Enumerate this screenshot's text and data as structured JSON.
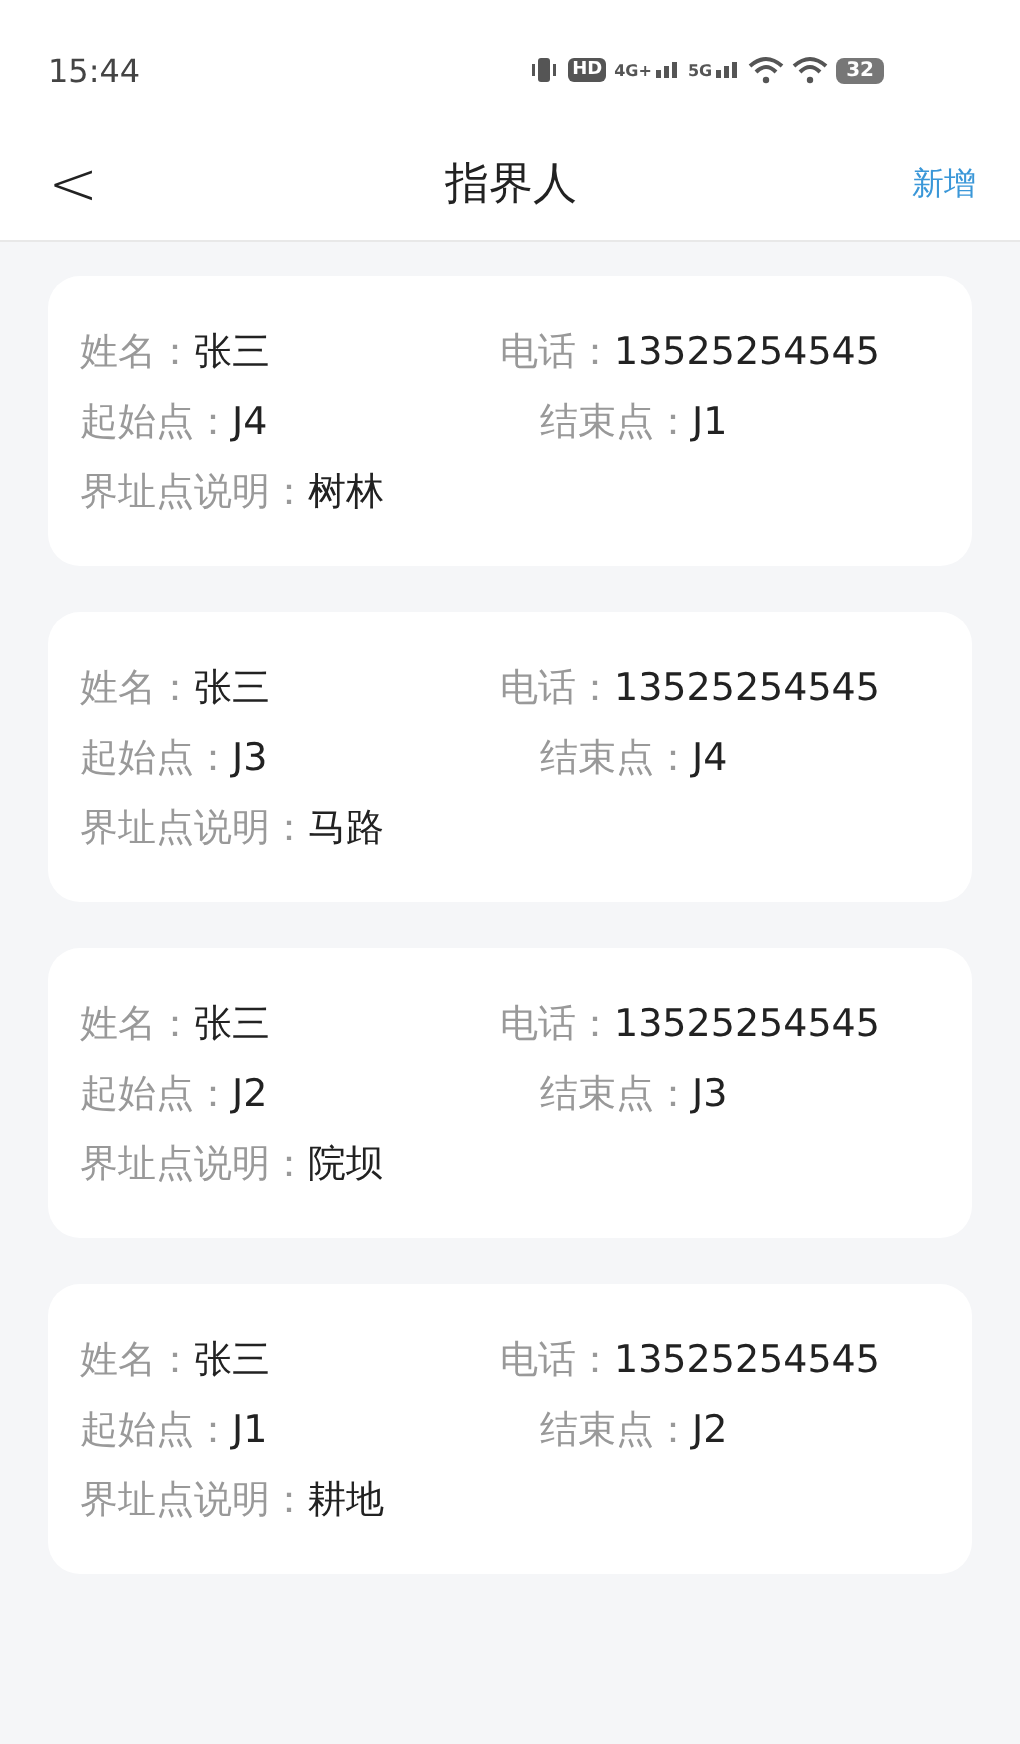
{
  "status_bar": {
    "time": "15:44",
    "hd": "HD",
    "network_1": "4G+",
    "network_2": "5G",
    "battery": "32"
  },
  "nav": {
    "back": "<",
    "title": "指界人",
    "action": "新增"
  },
  "records": [
    {
      "name_label": "姓名：",
      "name": "张三",
      "phone_label": "电话：",
      "phone": "13525254545",
      "start_label": "起始点：",
      "start": "J4",
      "end_label": "结束点：",
      "end": "J1",
      "desc_label": "界址点说明：",
      "desc": "树林"
    },
    {
      "name_label": "姓名：",
      "name": "张三",
      "phone_label": "电话：",
      "phone": "13525254545",
      "start_label": "起始点：",
      "start": "J3",
      "end_label": "结束点：",
      "end": "J4",
      "desc_label": "界址点说明：",
      "desc": "马路"
    },
    {
      "name_label": "姓名：",
      "name": "张三",
      "phone_label": "电话：",
      "phone": "13525254545",
      "start_label": "起始点：",
      "start": "J2",
      "end_label": "结束点：",
      "end": "J3",
      "desc_label": "界址点说明：",
      "desc": "院坝"
    },
    {
      "name_label": "姓名：",
      "name": "张三",
      "phone_label": "电话：",
      "phone": "13525254545",
      "start_label": "起始点：",
      "start": "J1",
      "end_label": "结束点：",
      "end": "J2",
      "desc_label": "界址点说明：",
      "desc": "耕地"
    }
  ]
}
